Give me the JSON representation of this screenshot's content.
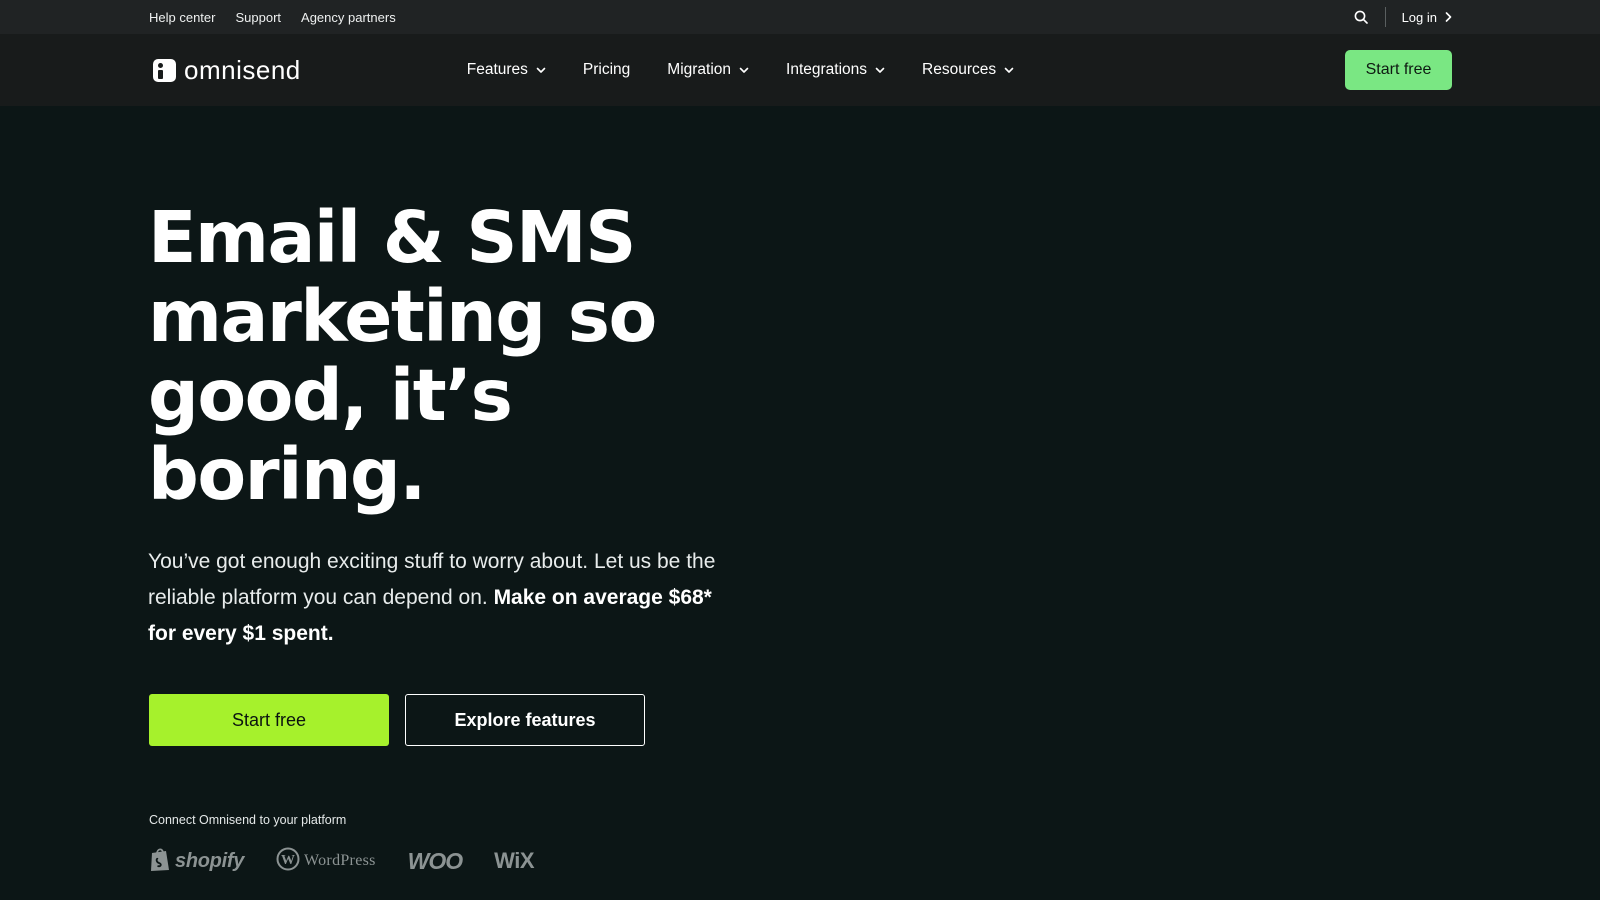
{
  "utility_bar": {
    "links": [
      "Help center",
      "Support",
      "Agency partners"
    ],
    "search_icon": "search-icon",
    "login_label": "Log in"
  },
  "nav": {
    "logo_text": "omnisend",
    "items": [
      {
        "label": "Features",
        "has_dropdown": true
      },
      {
        "label": "Pricing",
        "has_dropdown": false
      },
      {
        "label": "Migration",
        "has_dropdown": true
      },
      {
        "label": "Integrations",
        "has_dropdown": true
      },
      {
        "label": "Resources",
        "has_dropdown": true
      }
    ],
    "cta_label": "Start free"
  },
  "hero": {
    "title": "Email & SMS\nmarketing so\ngood, it’s\nboring.",
    "text_regular": "You’ve got enough exciting stuff to worry about. Let us be the reliable platform you can depend on. ",
    "text_bold": "Make on average $68* for every $1 spent.",
    "primary_button": "Start free",
    "secondary_button": "Explore features",
    "connect_label": "Connect Omnisend to your platform",
    "platforms": {
      "shopify": "shopify",
      "wordpress": "WordPress",
      "woo": "WOO",
      "wix": "WiX"
    }
  },
  "colors": {
    "background": "#0c1616",
    "utility_bar": "#202324",
    "nav_bar": "#181b1b",
    "nav_cta": "#7ae783",
    "primary_button": "#a6f12c",
    "logo_gray": "#8c9393"
  }
}
